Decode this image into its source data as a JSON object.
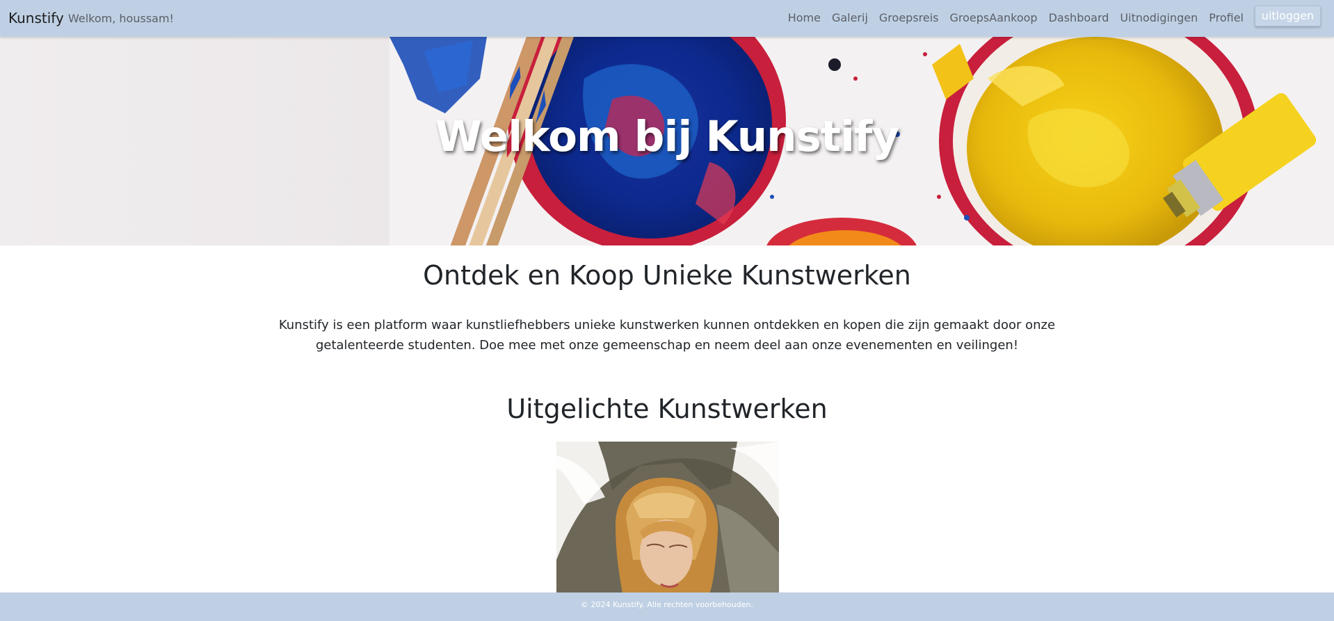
{
  "navbar": {
    "brand": "Kunstify",
    "welcome": "Welkom, houssam!",
    "links": [
      "Home",
      "Galerij",
      "Groepsreis",
      "GroepsAankoop",
      "Dashboard",
      "Uitnodigingen",
      "Profiel"
    ],
    "logout_label": "uitloggen",
    "background": "#bfd0e4"
  },
  "hero": {
    "title": "Welkom bij Kunstify",
    "image_icon": "paint-palette-image"
  },
  "intro": {
    "title": "Ontdek en Koop Unieke Kunstwerken",
    "text": "Kunstify is een platform waar kunstliefhebbers unieke kunstwerken kunnen ontdekken en kopen die zijn gemaakt door onze getalenteerde studenten. Doe mee met onze gemeenschap en neem deel aan onze evenementen en veilingen!"
  },
  "featured": {
    "title": "Uitgelichte Kunstwerken",
    "artwork_icon": "portrait-painting-image"
  },
  "footer": {
    "text": "© 2024 Kunstify. Alle rechten voorbehouden."
  }
}
